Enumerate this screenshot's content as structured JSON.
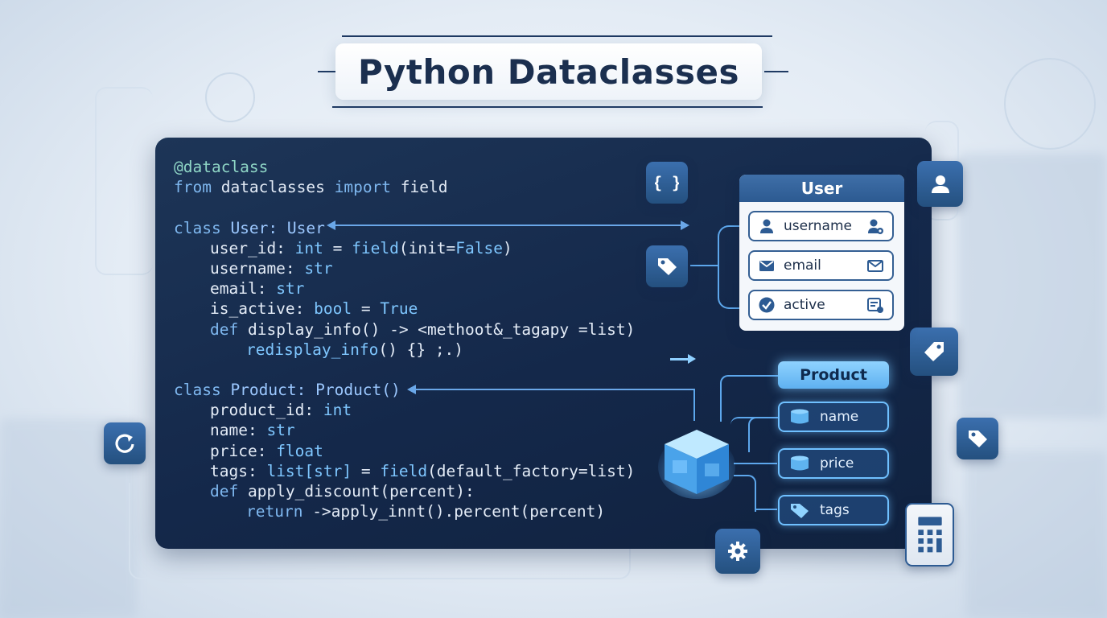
{
  "title": "Python Dataclasses",
  "code_lines": [
    {
      "indent": 0,
      "tokens": [
        {
          "t": "@dataclass",
          "c": "dec"
        }
      ]
    },
    {
      "indent": 0,
      "tokens": [
        {
          "t": "from",
          "c": "kw"
        },
        {
          "t": " dataclasses ",
          "c": ""
        },
        {
          "t": "import",
          "c": "kw"
        },
        {
          "t": " field",
          "c": ""
        }
      ]
    },
    {
      "indent": 0,
      "tokens": []
    },
    {
      "indent": 0,
      "tokens": [
        {
          "t": "class",
          "c": "kw"
        },
        {
          "t": " User: User",
          "c": "cls"
        }
      ]
    },
    {
      "indent": 1,
      "tokens": [
        {
          "t": "user_id: ",
          "c": ""
        },
        {
          "t": "int",
          "c": "ty"
        },
        {
          "t": " = ",
          "c": ""
        },
        {
          "t": "field",
          "c": "ty"
        },
        {
          "t": "(init=",
          "c": ""
        },
        {
          "t": "False",
          "c": "ty"
        },
        {
          "t": ")",
          "c": ""
        }
      ]
    },
    {
      "indent": 1,
      "tokens": [
        {
          "t": "username: ",
          "c": ""
        },
        {
          "t": "str",
          "c": "ty"
        }
      ]
    },
    {
      "indent": 1,
      "tokens": [
        {
          "t": "email: ",
          "c": ""
        },
        {
          "t": "str",
          "c": "ty"
        }
      ]
    },
    {
      "indent": 1,
      "tokens": [
        {
          "t": "is_active: ",
          "c": ""
        },
        {
          "t": "bool",
          "c": "ty"
        },
        {
          "t": " = ",
          "c": ""
        },
        {
          "t": "True",
          "c": "ty"
        }
      ]
    },
    {
      "indent": 1,
      "tokens": [
        {
          "t": "def",
          "c": "kw"
        },
        {
          "t": " display_info() -> <methoot&_tagapy =list)",
          "c": ""
        }
      ]
    },
    {
      "indent": 2,
      "tokens": [
        {
          "t": "redisplay_info",
          "c": "ty"
        },
        {
          "t": "() {} ;.)",
          "c": ""
        }
      ]
    },
    {
      "indent": 0,
      "tokens": []
    },
    {
      "indent": 0,
      "tokens": [
        {
          "t": "class",
          "c": "kw"
        },
        {
          "t": " Product: Product()",
          "c": "cls"
        }
      ]
    },
    {
      "indent": 1,
      "tokens": [
        {
          "t": "product_id: ",
          "c": ""
        },
        {
          "t": "int",
          "c": "ty"
        }
      ]
    },
    {
      "indent": 1,
      "tokens": [
        {
          "t": "name: ",
          "c": ""
        },
        {
          "t": "str",
          "c": "ty"
        }
      ]
    },
    {
      "indent": 1,
      "tokens": [
        {
          "t": "price: ",
          "c": ""
        },
        {
          "t": "float",
          "c": "ty"
        }
      ]
    },
    {
      "indent": 1,
      "tokens": [
        {
          "t": "tags: ",
          "c": ""
        },
        {
          "t": "list[str]",
          "c": "ty"
        },
        {
          "t": " = ",
          "c": ""
        },
        {
          "t": "field",
          "c": "ty"
        },
        {
          "t": "(default_factory=list)",
          "c": ""
        }
      ]
    },
    {
      "indent": 1,
      "tokens": [
        {
          "t": "def",
          "c": "kw"
        },
        {
          "t": " apply_discount(percent):",
          "c": ""
        }
      ]
    },
    {
      "indent": 2,
      "tokens": [
        {
          "t": "return",
          "c": "kw"
        },
        {
          "t": " ->apply_innt().percent(percent)",
          "c": ""
        }
      ]
    }
  ],
  "user_card": {
    "title": "User",
    "fields": [
      {
        "label": "username",
        "icon": "user-icon",
        "right_icon": "user-settings-icon"
      },
      {
        "label": "email",
        "icon": "envelope-icon",
        "right_icon": "envelope-icon"
      },
      {
        "label": "active",
        "icon": "check-circle-icon",
        "right_icon": "form-icon"
      }
    ]
  },
  "product_card": {
    "title": "Product",
    "fields": [
      {
        "label": "name",
        "icon": "database-icon"
      },
      {
        "label": "price",
        "icon": "database-icon"
      },
      {
        "label": "tags",
        "icon": "tag-icon"
      }
    ]
  },
  "tiles": [
    "braces-icon",
    "tag-icon",
    "user-icon",
    "tag-icon",
    "tag-icon",
    "gear-icon",
    "calculator-icon",
    "refresh-icon"
  ]
}
